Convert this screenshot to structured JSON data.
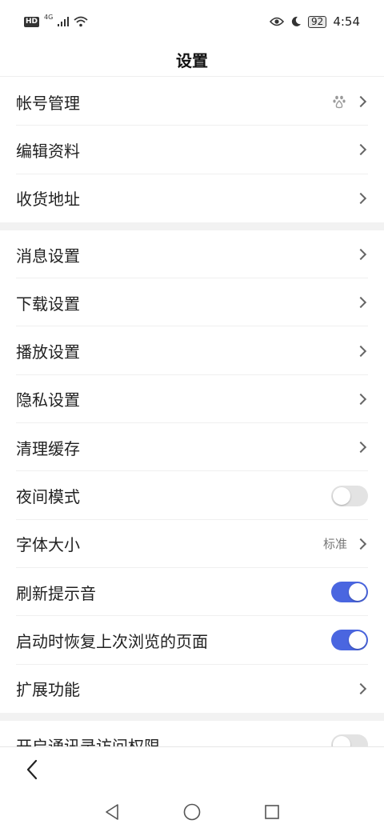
{
  "status_bar": {
    "hd": "HD",
    "network": "4G",
    "battery": "92",
    "time": "4:54"
  },
  "header": {
    "title": "设置"
  },
  "groups": [
    [
      {
        "label": "帐号管理",
        "control": "chevron",
        "icon": "baidu-paw-icon"
      },
      {
        "label": "编辑资料",
        "control": "chevron"
      },
      {
        "label": "收货地址",
        "control": "chevron"
      }
    ],
    [
      {
        "label": "消息设置",
        "control": "chevron"
      },
      {
        "label": "下载设置",
        "control": "chevron"
      },
      {
        "label": "播放设置",
        "control": "chevron"
      },
      {
        "label": "隐私设置",
        "control": "chevron"
      },
      {
        "label": "清理缓存",
        "control": "chevron"
      },
      {
        "label": "夜间模式",
        "control": "toggle",
        "on": false
      },
      {
        "label": "字体大小",
        "control": "chevron",
        "value": "标准"
      },
      {
        "label": "刷新提示音",
        "control": "toggle",
        "on": true
      },
      {
        "label": "启动时恢复上次浏览的页面",
        "control": "toggle",
        "on": true
      },
      {
        "label": "扩展功能",
        "control": "chevron"
      }
    ],
    [
      {
        "label": "开启通讯录访问权限",
        "control": "toggle",
        "on": false
      }
    ]
  ],
  "colors": {
    "accent": "#4a66e0",
    "toggle_off": "#e3e3e3",
    "section_gap": "#f2f2f2"
  },
  "toolbar": {
    "back_icon": "chevron-left-icon"
  },
  "system_nav": [
    "back-triangle-icon",
    "home-circle-icon",
    "recents-square-icon"
  ]
}
